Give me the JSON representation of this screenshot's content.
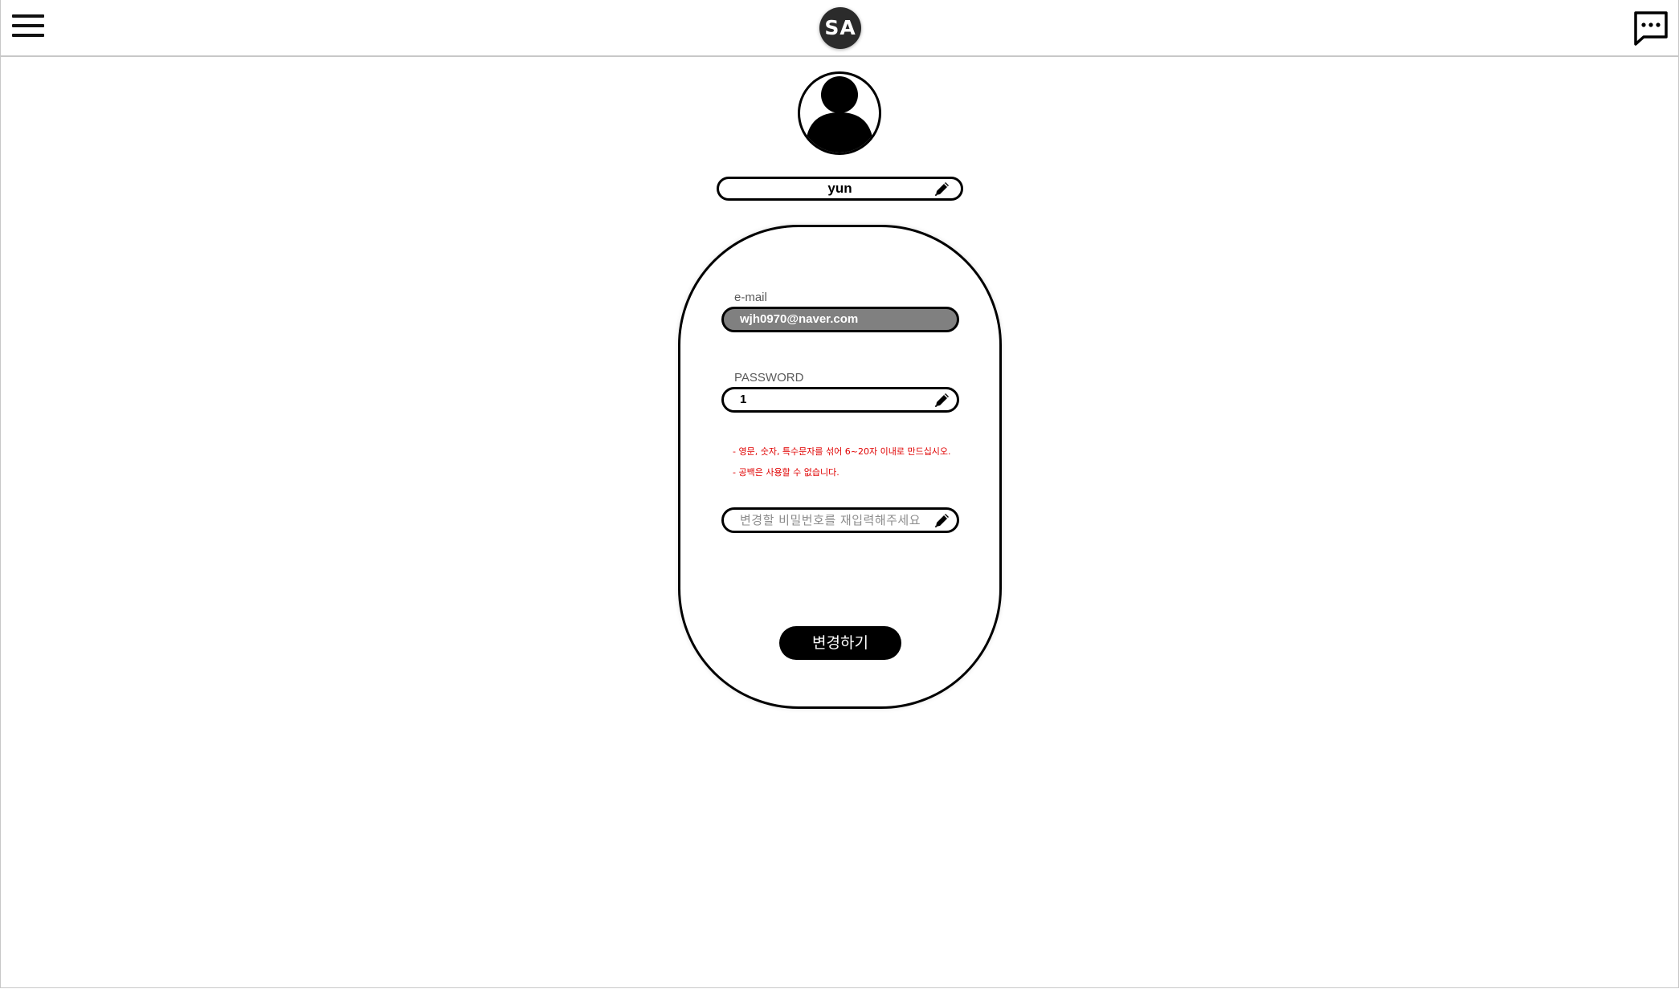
{
  "header": {
    "logo_text": "SA",
    "menu_icon": "hamburger-menu-icon",
    "chat_icon": "chat-bubble-icon"
  },
  "profile": {
    "avatar_icon": "user-avatar-icon",
    "name": "yun"
  },
  "form": {
    "email_label": "e-mail",
    "email_value": "wjh0970@naver.com",
    "password_label": "PASSWORD",
    "password_value": "1",
    "hints": [
      "- 영문, 숫자, 특수문자를 섞어 6~20자 이내로 만드십시오.",
      "- 공백은 사용할 수 없습니다."
    ],
    "confirm_placeholder": "변경할 비밀번호를 재입력해주세요",
    "submit_label": "변경하기"
  },
  "colors": {
    "hint_text": "#e00000",
    "email_bg": "#808080",
    "button_bg": "#000000"
  }
}
